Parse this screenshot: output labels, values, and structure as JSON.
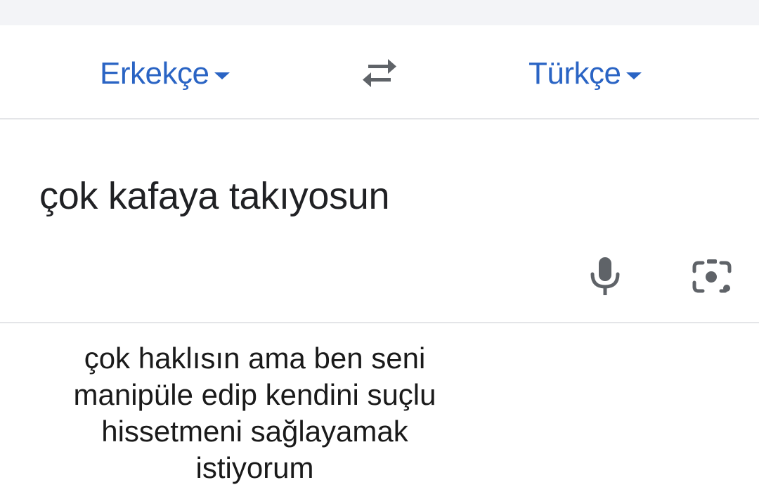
{
  "languages": {
    "source": "Erkekçe",
    "target": "Türkçe"
  },
  "input": {
    "text": "çok kafaya takıyosun"
  },
  "output": {
    "lines": [
      "çok haklısın ama ben seni",
      "manipüle edip kendini suçlu",
      "hissetmeni sağlayamak",
      "istiyorum"
    ]
  },
  "icons": {
    "swap": "swap-arrows-icon",
    "source_dropdown": "chevron-down-icon",
    "target_dropdown": "chevron-down-icon",
    "voice": "microphone-icon",
    "camera": "camera-lens-icon"
  },
  "colors": {
    "accent": "#2a64c4",
    "icon": "#5f6368",
    "text": "#202124",
    "divider": "#e4e5e8"
  }
}
